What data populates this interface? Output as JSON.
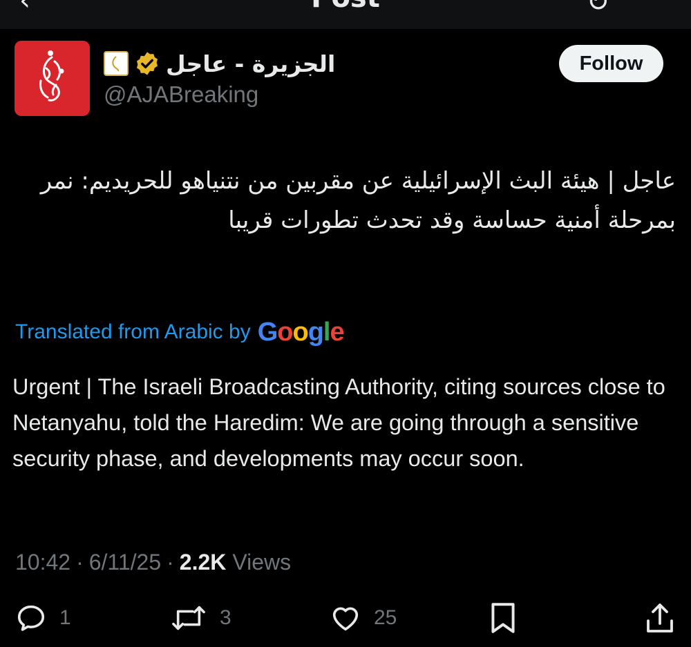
{
  "header": {
    "title": "Post",
    "back_icon": "back-arrow-icon",
    "right_icon": "refresh-icon"
  },
  "author": {
    "display_name": "الجزيرة - عاجل",
    "handle": "@AJABreaking",
    "verified": true,
    "verified_badge_color": "#e8b829",
    "logo_bg_color": "#d9262c",
    "follow_label": "Follow"
  },
  "post": {
    "arabic_text": "عاجل | هيئة البث الإسرائيلية عن مقربين من نتنياهو للحريديم: نمر بمرحلة أمنية حساسة وقد تحدث تطورات قريبا",
    "translated_label": "Translated from Arabic by",
    "translator": "Google",
    "english_text": "Urgent | The Israeli Broadcasting Authority, citing sources close to Netanyahu, told the Haredim: We are going through a sensitive security phase, and developments may occur soon.",
    "time": "10:42",
    "date": "6/11/25",
    "views_count": "2.2K",
    "views_label": "Views",
    "separator": "·"
  },
  "actions": {
    "replies": "1",
    "reposts": "3",
    "likes": "25",
    "reply_icon": "reply-icon",
    "repost_icon": "repost-icon",
    "like_icon": "heart-icon",
    "bookmark_icon": "bookmark-icon",
    "share_icon": "share-icon"
  },
  "colors": {
    "background": "#000000",
    "text": "#e7e9ea",
    "muted": "#71767b",
    "link": "#1d9bf0"
  }
}
